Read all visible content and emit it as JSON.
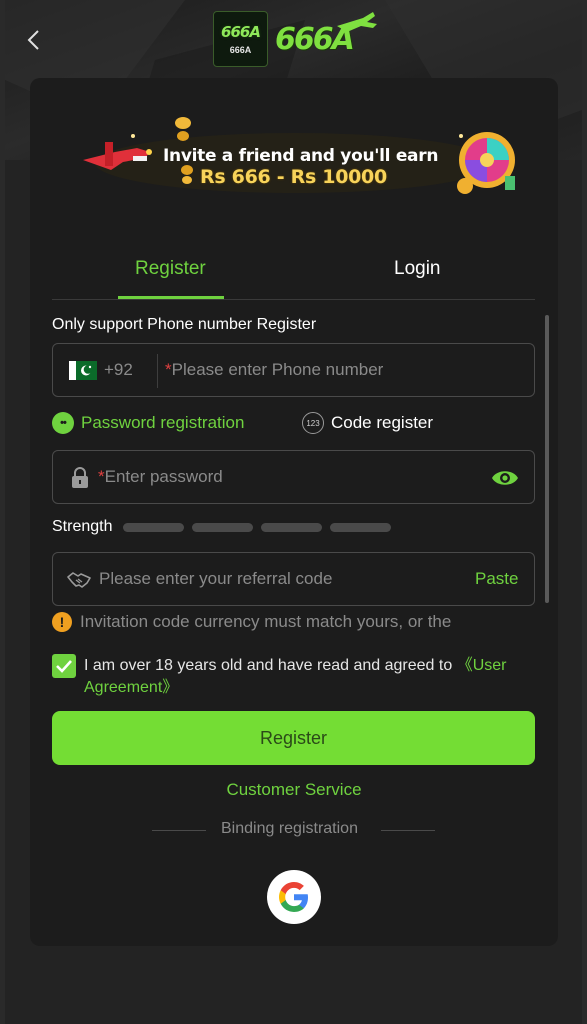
{
  "header": {
    "logo_icon_text": "666A",
    "logo_icon_subtext": "666A",
    "logo_text": "666A"
  },
  "banner": {
    "line1": "Invite a friend and you'll earn",
    "line2": "Rs 666 - Rs 10000"
  },
  "tabs": [
    {
      "label": "Register",
      "active": true
    },
    {
      "label": "Login",
      "active": false
    }
  ],
  "form": {
    "phone_only_label": "Only support Phone number Register",
    "dial_code": "+92",
    "phone_placeholder": "Please enter Phone number",
    "required_mark": "*",
    "reg_types": {
      "password": "Password registration",
      "code": "Code register",
      "code_icon": "123"
    },
    "password_placeholder": "Enter password",
    "strength_label": "Strength",
    "referral_placeholder": "Please enter your referral code",
    "paste_label": "Paste",
    "notice_icon": "!",
    "notice": "Invitation code currency must match yours, or the",
    "agree_text": "I am over 18 years old and have read and agreed to ",
    "agree_link": "《User Agreement》",
    "agree_checked": true,
    "register_button": "Register"
  },
  "footer": {
    "customer_service": "Customer Service",
    "binding_label": "Binding registration"
  },
  "colors": {
    "accent": "#6fd23f",
    "button": "#74dd34",
    "card_bg": "#1c1c1c",
    "page_bg": "#2a2a2a",
    "warning": "#f0a020"
  },
  "icons": [
    "back-arrow-icon",
    "pakistan-flag-icon",
    "lock-icon",
    "eye-icon",
    "handshake-icon",
    "warning-icon",
    "checkmark-icon",
    "google-icon"
  ]
}
